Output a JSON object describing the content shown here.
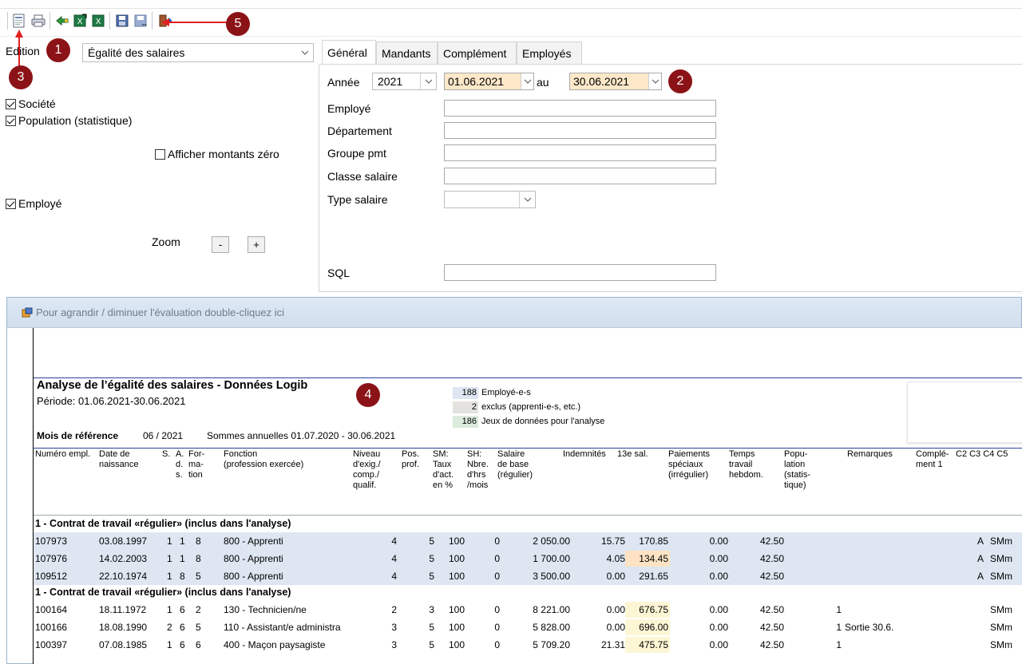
{
  "toolbar": {
    "icons": [
      "preview-icon",
      "print-icon",
      "back-icon",
      "excel-export-icon",
      "excel-icon",
      "save-icon",
      "save-as-icon",
      "exit-icon"
    ]
  },
  "callouts": [
    "1",
    "2",
    "3",
    "4",
    "5"
  ],
  "colors": {
    "callout": "#8b1317",
    "date_bg": "#fde8c9",
    "row_shade": "#dde6f1",
    "arrow": "#e02020"
  },
  "left": {
    "edition_label": "Edition",
    "edition_value": "Égalité des salaires",
    "checks": [
      {
        "label": "Société",
        "checked": true
      },
      {
        "label": "Population (statistique)",
        "checked": true
      },
      {
        "label": "Afficher montants zéro",
        "checked": false
      },
      {
        "label": "Employé",
        "checked": true
      }
    ],
    "zoom_label": "Zoom",
    "zoom_minus": "-",
    "zoom_plus": "+"
  },
  "tabs": [
    "Général",
    "Mandants",
    "Complément",
    "Employés"
  ],
  "form": {
    "annee_label": "Année",
    "annee_value": "2021",
    "date_from": "01.06.2021",
    "au_label": "au",
    "date_to": "30.06.2021",
    "fields": [
      "Employé",
      "Département",
      "Groupe pmt",
      "Classe salaire",
      "Type salaire"
    ],
    "sql_label": "SQL"
  },
  "report": {
    "window_title": "Pour agrandir / diminuer l'évaluation double-cliquez ici",
    "title": "Analyse de l’égalité des salaires - Données Logib",
    "period": "Période: 01.06.2021-30.06.2021",
    "ref_label": "Mois de référence",
    "ref_value": "06 / 2021",
    "sums": "Sommes annuelles 01.07.2020 - 30.06.2021",
    "legend": [
      {
        "count": "188",
        "text": "Employé-e-s",
        "color": "#dde6f1"
      },
      {
        "count": "2",
        "text": "exclus (apprenti-e-s, etc.)",
        "color": "#e5e3df"
      },
      {
        "count": "186",
        "text": "Jeux de données pour l'analyse",
        "color": "#dcebdc"
      }
    ],
    "headers": [
      "Numéro empl.",
      "Date de\nnaissance",
      "S.",
      "A.\nd.\ns.",
      "For-\nma-\ntion",
      "Fonction\n(profession exercée)",
      "Niveau\nd'exig./\ncomp./\nqualif.",
      "Pos.\nprof.",
      "SM:\nTaux\nd'act.\nen %",
      "SH:\nNbre.\nd'hrs\n/mois",
      "Salaire\nde base\n(régulier)",
      "Indemnités",
      "13e sal.",
      "Paiements\nspéciaux\n(irrégulier)",
      "Temps\ntravail\nhebdom.",
      "Popu-\nlation\n(statis-\ntique)",
      "Remarques",
      "Complé-\nment 1",
      "C2 C3 C4 C5"
    ],
    "section1": "1 - Contrat de travail «régulier» (inclus dans l'analyse)",
    "rows1": [
      [
        "107973",
        "03.08.1997",
        "1",
        "1",
        "8",
        "800 - Apprenti",
        "4",
        "5",
        "100",
        "0",
        "2 050.00",
        "15.75",
        "170.85",
        "0.00",
        "42.50",
        "",
        "",
        "A",
        "SMm"
      ],
      [
        "107976",
        "14.02.2003",
        "1",
        "1",
        "8",
        "800 - Apprenti",
        "4",
        "5",
        "100",
        "0",
        "1 700.00",
        "4.05",
        "134.45",
        "0.00",
        "42.50",
        "",
        "",
        "A",
        "SMm"
      ],
      [
        "109512",
        "22.10.1974",
        "1",
        "8",
        "5",
        "800 - Apprenti",
        "4",
        "5",
        "100",
        "0",
        "3 500.00",
        "0.00",
        "291.65",
        "0.00",
        "42.50",
        "",
        "",
        "A",
        "SMm"
      ]
    ],
    "section2": "1 - Contrat de travail «régulier» (inclus dans l'analyse)",
    "rows2": [
      [
        "100164",
        "18.11.1972",
        "1",
        "6",
        "2",
        "130 - Technicien/ne",
        "2",
        "3",
        "100",
        "0",
        "8 221.00",
        "0.00",
        "676.75",
        "0.00",
        "42.50",
        "1",
        "",
        "",
        "SMm"
      ],
      [
        "100166",
        "18.08.1990",
        "2",
        "6",
        "5",
        "110 - Assistant/e administra",
        "3",
        "5",
        "100",
        "0",
        "5 828.00",
        "0.00",
        "696.00",
        "0.00",
        "42.50",
        "1",
        "Sortie 30.6.",
        "",
        "SMm"
      ],
      [
        "100397",
        "07.08.1985",
        "1",
        "6",
        "6",
        "400 - Maçon paysagiste",
        "3",
        "5",
        "100",
        "0",
        "5 709.20",
        "21.31",
        "475.75",
        "0.00",
        "42.50",
        "1",
        "",
        "",
        "SMm"
      ]
    ]
  }
}
